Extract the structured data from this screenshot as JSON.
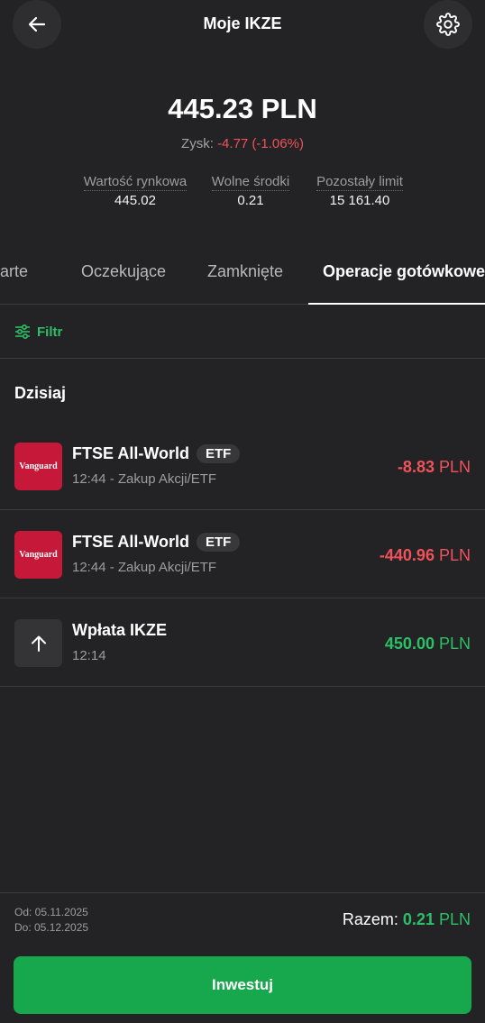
{
  "header": {
    "title": "Moje IKZE",
    "back_icon": "arrow-left-icon",
    "settings_icon": "gear-icon"
  },
  "summary": {
    "balance": "445.23 PLN",
    "profit_label": "Zysk:",
    "profit_value": "-4.77 (-1.06%)",
    "stats": [
      {
        "label": "Wartość rynkowa",
        "value": "445.02"
      },
      {
        "label": "Wolne środki",
        "value": "0.21"
      },
      {
        "label": "Pozostały limit",
        "value": "15 161.40"
      }
    ]
  },
  "tabs": [
    {
      "label": "arte",
      "active": false
    },
    {
      "label": "Oczekujące",
      "active": false
    },
    {
      "label": "Zamknięte",
      "active": false
    },
    {
      "label": "Operacje gotówkowe",
      "active": true
    }
  ],
  "filter": {
    "label": "Filtr",
    "icon": "sliders-icon"
  },
  "section": {
    "title": "Dzisiaj"
  },
  "transactions": [
    {
      "logo_text": "Vanguard",
      "name": "FTSE All-World",
      "badge": "ETF",
      "subtitle": "12:44 - Zakup Akcji/ETF",
      "amount": "-8.83",
      "currency": "PLN",
      "type": "negative"
    },
    {
      "logo_text": "Vanguard",
      "name": "FTSE All-World",
      "badge": "ETF",
      "subtitle": "12:44 - Zakup Akcji/ETF",
      "amount": "-440.96",
      "currency": "PLN",
      "type": "negative"
    },
    {
      "icon": "arrow-up-icon",
      "name": "Wpłata IKZE",
      "subtitle": "12:14",
      "amount": "450.00",
      "currency": "PLN",
      "type": "positive"
    }
  ],
  "footer": {
    "date_from": "Od: 05.11.2025",
    "date_to": "Do: 05.12.2025",
    "total_label": "Razem:",
    "total_amount": "0.21",
    "total_currency": "PLN",
    "invest_button": "Inwestuj"
  },
  "colors": {
    "background": "#232325",
    "accent_green": "#17a74d",
    "negative_red": "#f0525b",
    "vanguard_red": "#c6193a"
  }
}
